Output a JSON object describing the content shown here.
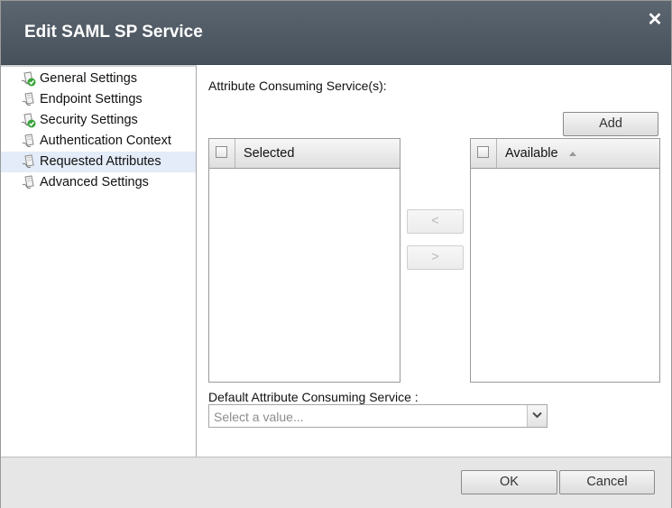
{
  "dialog": {
    "title": "Edit SAML SP Service",
    "close_glyph": "✕"
  },
  "nav": {
    "items": [
      {
        "label": "General Settings",
        "icon": "document-check-icon",
        "active": false
      },
      {
        "label": "Endpoint Settings",
        "icon": "document-icon",
        "active": false
      },
      {
        "label": "Security Settings",
        "icon": "document-check-icon",
        "active": false
      },
      {
        "label": "Authentication Context",
        "icon": "document-icon",
        "active": false
      },
      {
        "label": "Requested Attributes",
        "icon": "document-icon",
        "active": true
      },
      {
        "label": "Advanced Settings",
        "icon": "document-icon",
        "active": false
      }
    ]
  },
  "main": {
    "acs_label": "Attribute Consuming Service(s):",
    "add_label": "Add",
    "selected_header": "Selected",
    "available_header": "Available",
    "move_left_label": "<",
    "move_right_label": ">",
    "default_acs_label": "Default Attribute Consuming Service  :",
    "default_acs_placeholder": "Select a value..."
  },
  "footer": {
    "ok_label": "OK",
    "cancel_label": "Cancel"
  },
  "colors": {
    "titlebar": "#4f5962",
    "active_nav": "#e3ecf8",
    "check_green": "#3aa33a"
  }
}
